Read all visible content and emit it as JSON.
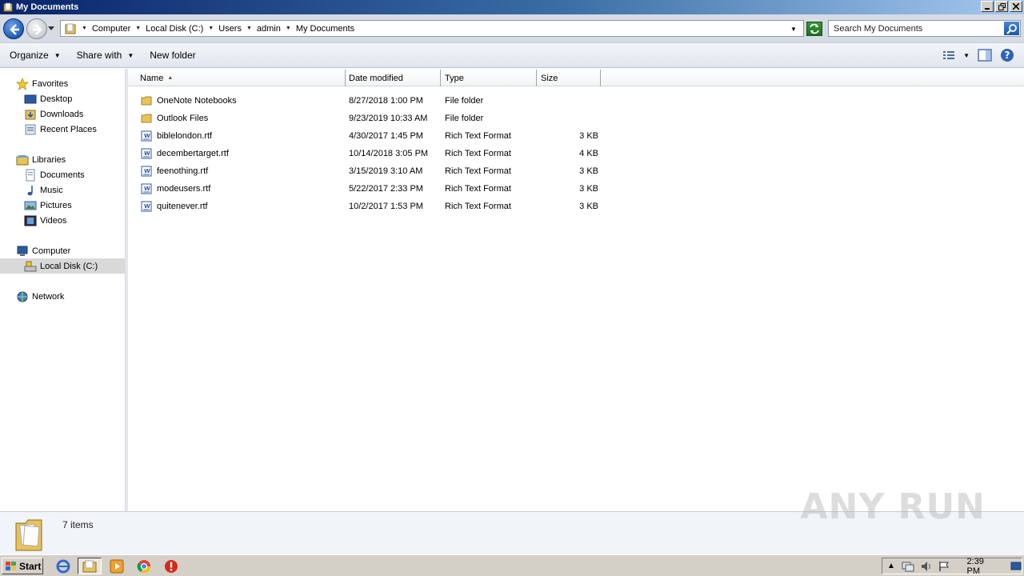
{
  "window": {
    "title": "My Documents"
  },
  "address": {
    "crumbs": [
      "Computer",
      "Local Disk (C:)",
      "Users",
      "admin",
      "My Documents"
    ]
  },
  "search": {
    "placeholder": "Search My Documents"
  },
  "toolbar": {
    "organize": "Organize",
    "share_with": "Share with",
    "new_folder": "New folder"
  },
  "navpane": {
    "favorites": "Favorites",
    "desktop": "Desktop",
    "downloads": "Downloads",
    "recent_places": "Recent Places",
    "libraries": "Libraries",
    "documents": "Documents",
    "music": "Music",
    "pictures": "Pictures",
    "videos": "Videos",
    "computer": "Computer",
    "local_disk": "Local Disk (C:)",
    "network": "Network"
  },
  "columns": {
    "name": "Name",
    "date_modified": "Date modified",
    "type": "Type",
    "size": "Size"
  },
  "files": [
    {
      "name": "OneNote Notebooks",
      "date": "8/27/2018 1:00 PM",
      "type": "File folder",
      "size": "",
      "kind": "folder"
    },
    {
      "name": "Outlook Files",
      "date": "9/23/2019 10:33 AM",
      "type": "File folder",
      "size": "",
      "kind": "folder"
    },
    {
      "name": "biblelondon.rtf",
      "date": "4/30/2017 1:45 PM",
      "type": "Rich Text Format",
      "size": "3 KB",
      "kind": "rtf"
    },
    {
      "name": "decembertarget.rtf",
      "date": "10/14/2018 3:05 PM",
      "type": "Rich Text Format",
      "size": "4 KB",
      "kind": "rtf"
    },
    {
      "name": "feenothing.rtf",
      "date": "3/15/2019 3:10 AM",
      "type": "Rich Text Format",
      "size": "3 KB",
      "kind": "rtf"
    },
    {
      "name": "modeusers.rtf",
      "date": "5/22/2017 2:33 PM",
      "type": "Rich Text Format",
      "size": "3 KB",
      "kind": "rtf"
    },
    {
      "name": "quitenever.rtf",
      "date": "10/2/2017 1:53 PM",
      "type": "Rich Text Format",
      "size": "3 KB",
      "kind": "rtf"
    }
  ],
  "details": {
    "item_count": "7 items"
  },
  "watermark": "ANY RUN",
  "taskbar": {
    "start": "Start",
    "clock": "2:39 PM"
  },
  "colors": {
    "title_gradient_start": "#0a246a",
    "title_gradient_end": "#a6caf0",
    "folder_yellow": "#e8c35a",
    "taskbar_gray": "#d4d0c8"
  }
}
